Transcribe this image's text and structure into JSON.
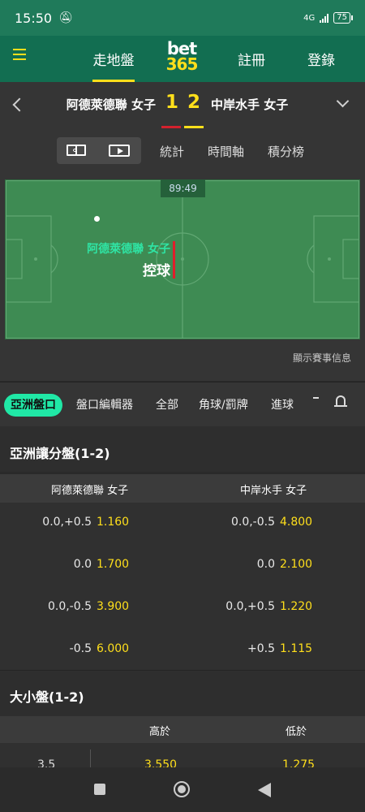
{
  "status_bar": {
    "time": "15:50",
    "network": "4G",
    "battery": "75"
  },
  "top_nav": {
    "live": "走地盤",
    "logo_top": "bet",
    "logo_bottom": "365",
    "register": "註冊",
    "login": "登錄"
  },
  "match": {
    "home_team": "阿德萊德聯 女子",
    "away_team": "中岸水手 女子",
    "home_score": "1",
    "away_score": "2"
  },
  "view_tabs": {
    "stats": "統計",
    "timeline": "時間軸",
    "standings": "積分榜"
  },
  "pitch": {
    "clock": "89:49",
    "possession_team": "阿德萊德聯 女子",
    "possession_label": "控球",
    "show_info": "顯示賽事信息"
  },
  "market_tabs": {
    "asian": "亞洲盤口",
    "editor": "盤口編輯器",
    "all": "全部",
    "corners": "角球/罰牌",
    "goals": "進球"
  },
  "asian_handicap": {
    "title": "亞洲讓分盤(1-2)",
    "home_header": "阿德萊德聯 女子",
    "away_header": "中岸水手 女子",
    "rows": [
      {
        "home_line": "0.0,+0.5",
        "home_odds": "1.160",
        "away_line": "0.0,-0.5",
        "away_odds": "4.800"
      },
      {
        "home_line": "0.0",
        "home_odds": "1.700",
        "away_line": "0.0",
        "away_odds": "2.100"
      },
      {
        "home_line": "0.0,-0.5",
        "home_odds": "3.900",
        "away_line": "0.0,+0.5",
        "away_odds": "1.220"
      },
      {
        "home_line": "-0.5",
        "home_odds": "6.000",
        "away_line": "+0.5",
        "away_odds": "1.115"
      }
    ]
  },
  "over_under": {
    "title": "大小盤(1-2)",
    "over_header": "高於",
    "under_header": "低於",
    "rows": [
      {
        "line": "3.5",
        "over": "3.550",
        "under": "1.275"
      }
    ]
  }
}
